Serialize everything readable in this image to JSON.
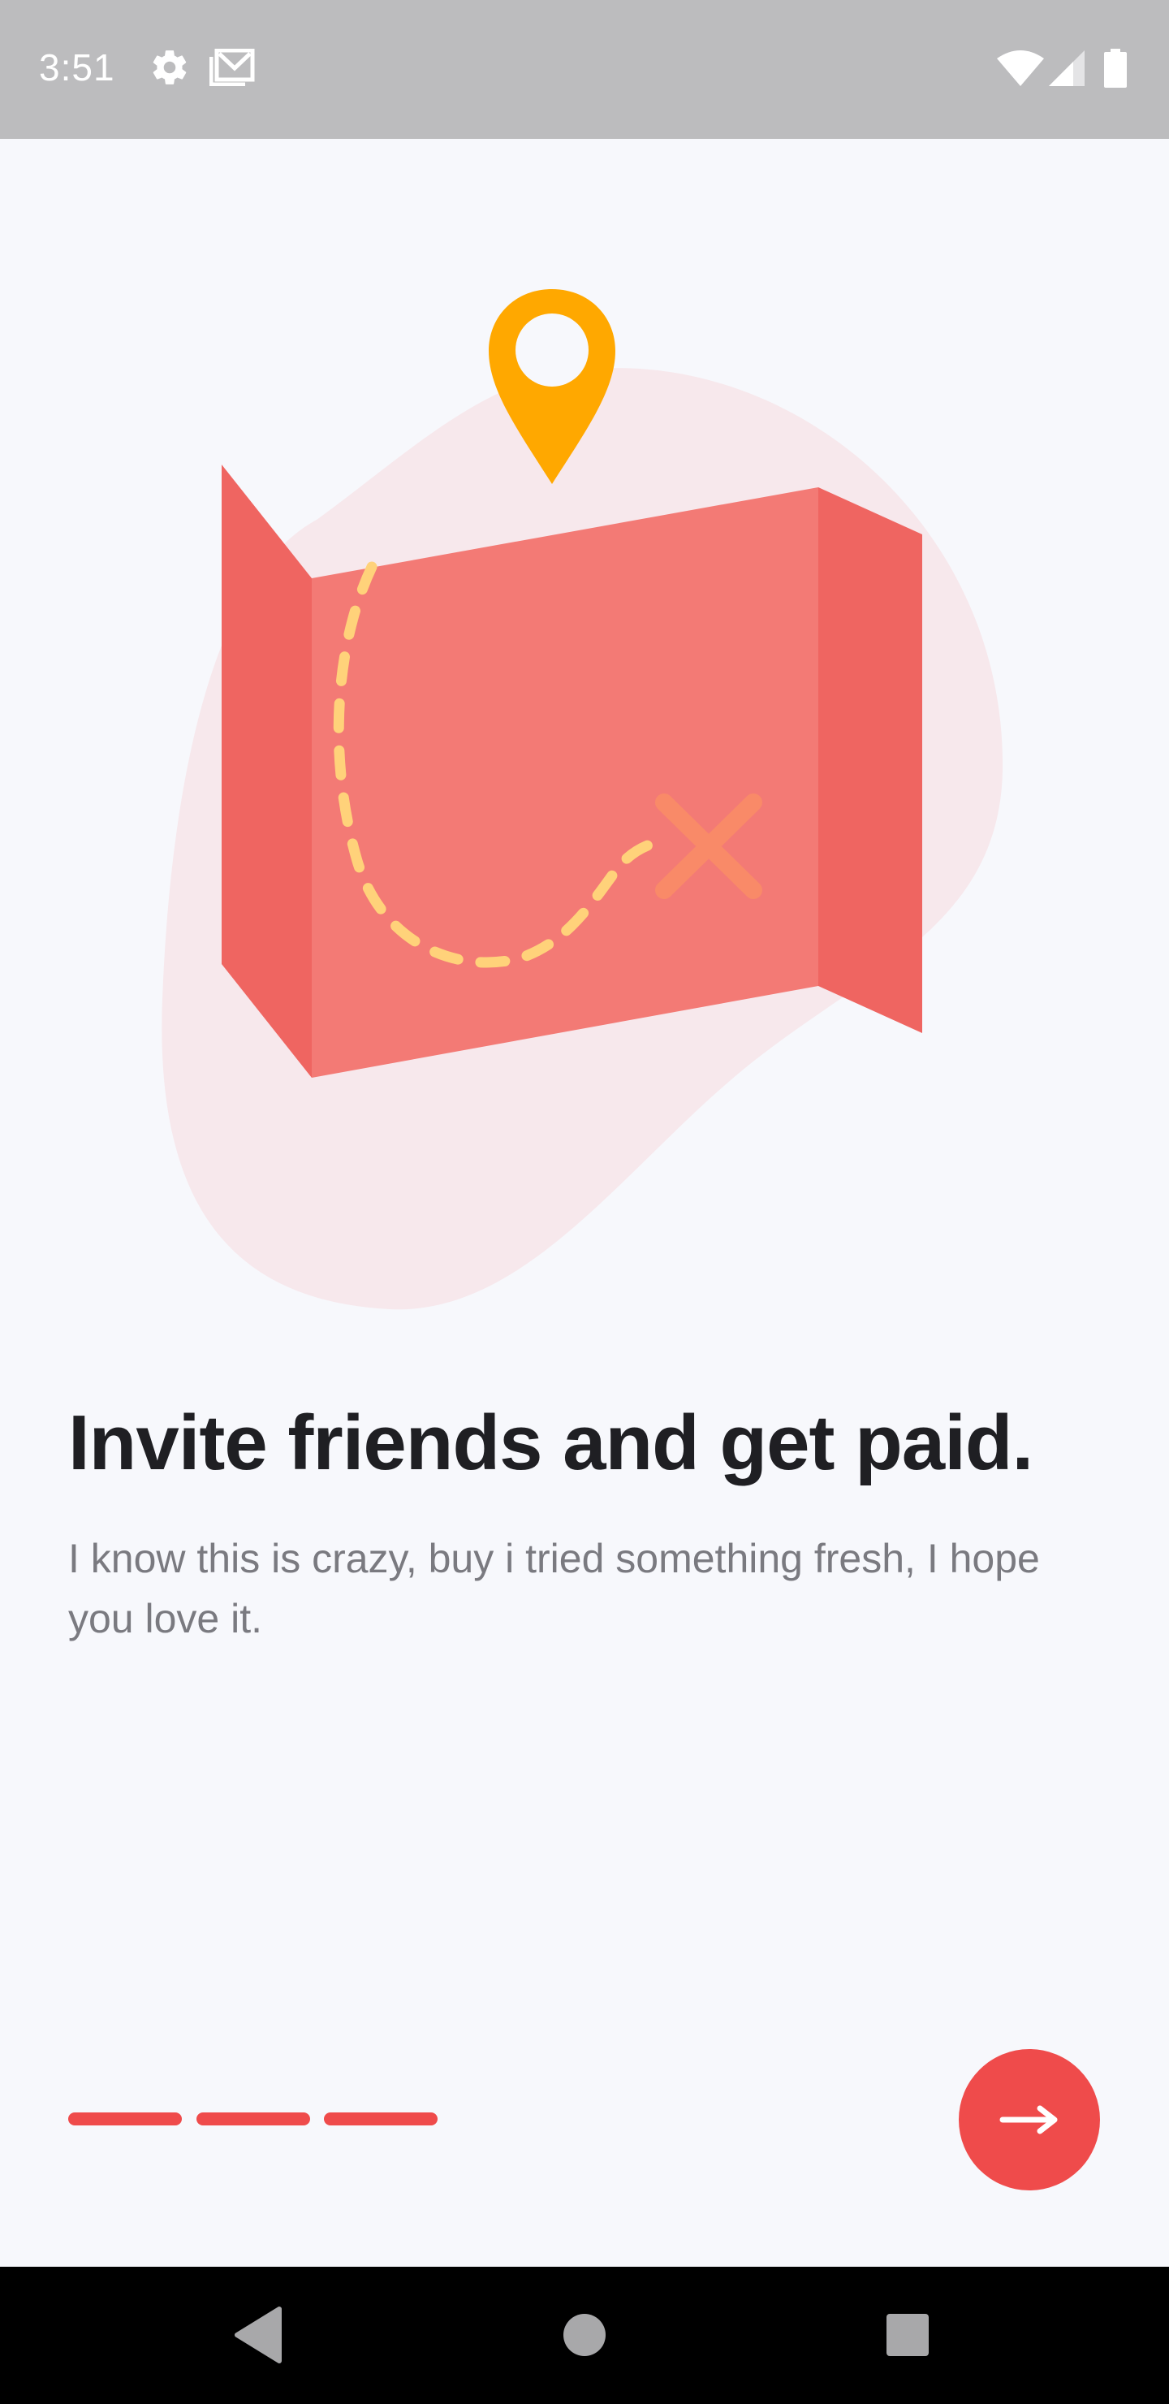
{
  "status_bar": {
    "time": "3:51",
    "icons": [
      "settings-icon",
      "gmail-icon",
      "wifi-icon",
      "signal-icon",
      "battery-icon"
    ]
  },
  "onboarding": {
    "illustration": "treasure-map-illustration",
    "title": "Invite friends and get paid.",
    "subtitle": "I know this is crazy, buy i tried something fresh, I hope you love it.",
    "page_indicators": [
      {
        "active": true
      },
      {
        "active": true
      },
      {
        "active": true
      }
    ],
    "next_button_icon": "arrow-right-icon"
  },
  "navigation_bar": {
    "buttons": [
      "back-icon",
      "home-icon",
      "recents-icon"
    ]
  },
  "colors": {
    "accent": "#ef4b4b",
    "map_front": "#f37a75",
    "map_side": "#ef6561",
    "pin": "#ffa800",
    "blob": "#f7e8ec",
    "path": "#ffd27a",
    "x_mark": "#f98a68",
    "title": "#1f1f23",
    "subtitle": "#7a7a80"
  }
}
